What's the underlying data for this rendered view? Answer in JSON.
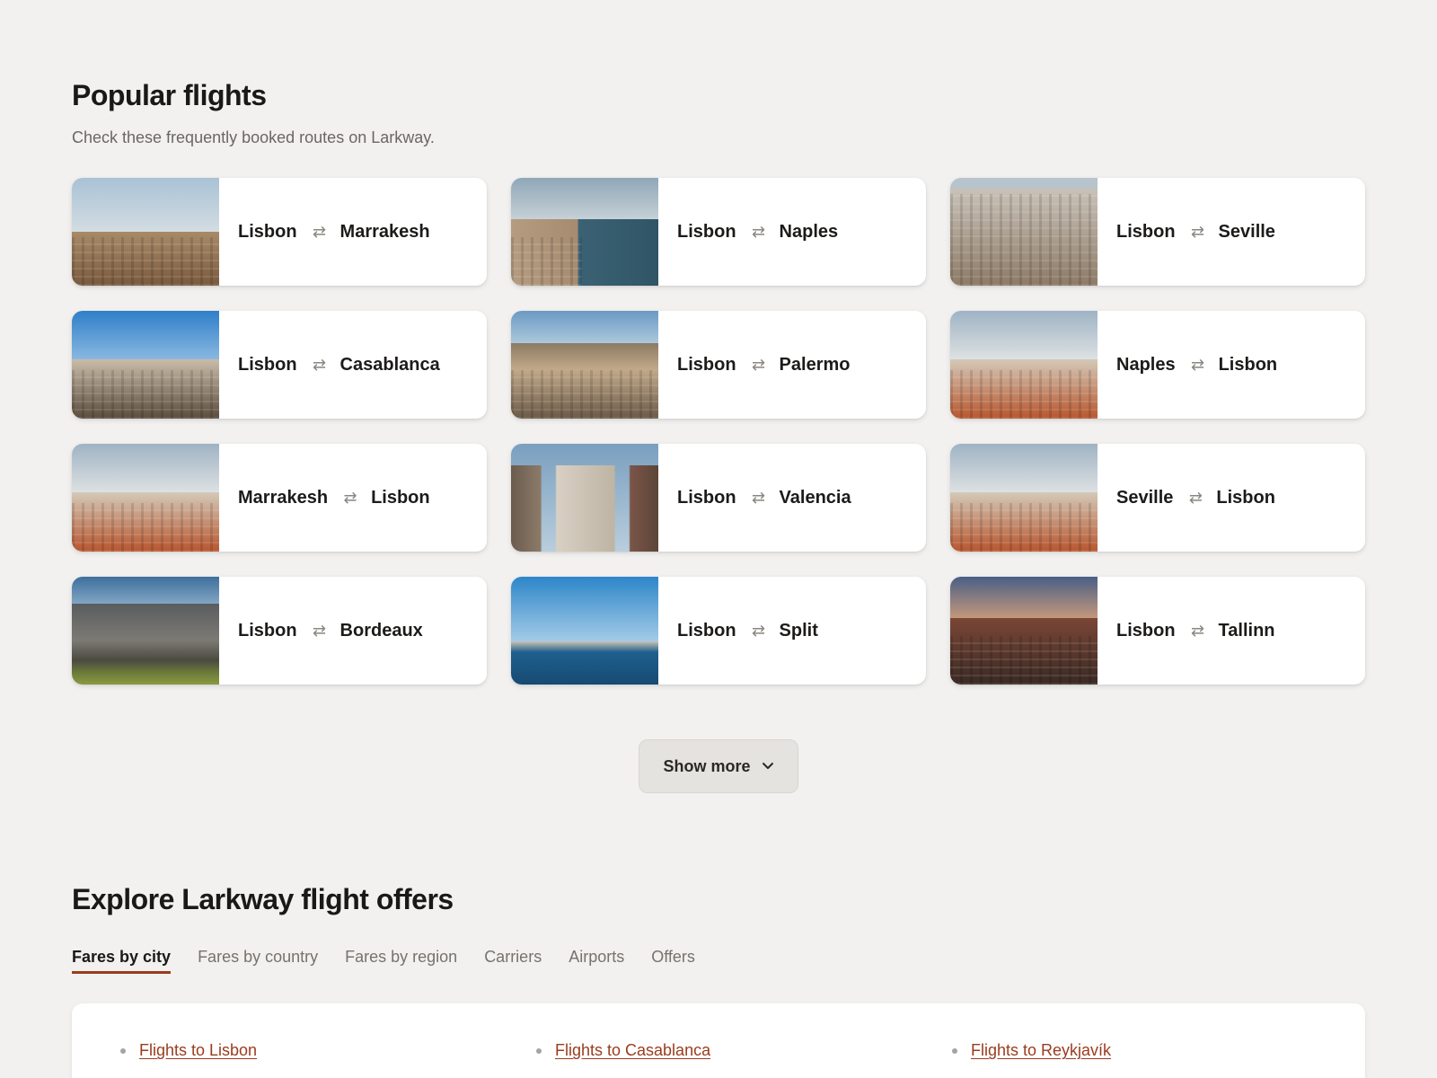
{
  "popular": {
    "title": "Popular flights",
    "subtitle": "Check these frequently booked routes on Larkway."
  },
  "routes": [
    {
      "from": "Lisbon",
      "to": "Marrakesh",
      "image": "city-skyline-marrakesh"
    },
    {
      "from": "Lisbon",
      "to": "Naples",
      "image": "bay-naples"
    },
    {
      "from": "Lisbon",
      "to": "Seville",
      "image": "city-aerial-seville"
    },
    {
      "from": "Lisbon",
      "to": "Casablanca",
      "image": "city-casablanca"
    },
    {
      "from": "Lisbon",
      "to": "Palermo",
      "image": "mountain-city-palermo"
    },
    {
      "from": "Naples",
      "to": "Lisbon",
      "image": "rooftops-lisbon"
    },
    {
      "from": "Marrakesh",
      "to": "Lisbon",
      "image": "rooftops-lisbon"
    },
    {
      "from": "Lisbon",
      "to": "Valencia",
      "image": "buildings-valencia"
    },
    {
      "from": "Seville",
      "to": "Lisbon",
      "image": "rooftops-lisbon"
    },
    {
      "from": "Lisbon",
      "to": "Bordeaux",
      "image": "waterfront-bordeaux"
    },
    {
      "from": "Lisbon",
      "to": "Split",
      "image": "sea-split"
    },
    {
      "from": "Lisbon",
      "to": "Tallinn",
      "image": "old-town-tallinn"
    }
  ],
  "icons": {
    "swap": "swap-arrows-icon",
    "chevron": "chevron-down-icon"
  },
  "show_more": {
    "label": "Show more"
  },
  "explore": {
    "title": "Explore Larkway flight offers",
    "tabs": [
      {
        "label": "Fares by city",
        "active": true
      },
      {
        "label": "Fares by country",
        "active": false
      },
      {
        "label": "Fares by region",
        "active": false
      },
      {
        "label": "Carriers",
        "active": false
      },
      {
        "label": "Airports",
        "active": false
      },
      {
        "label": "Offers",
        "active": false
      }
    ],
    "links": [
      {
        "label": "Flights to Lisbon"
      },
      {
        "label": "Flights to Casablanca"
      },
      {
        "label": "Flights to Reykjavík"
      }
    ]
  },
  "colors": {
    "background": "#f2f1ef",
    "card": "#ffffff",
    "accent": "#9a3c1e",
    "muted_text": "#6b6762",
    "button_bg": "#e5e3df"
  }
}
